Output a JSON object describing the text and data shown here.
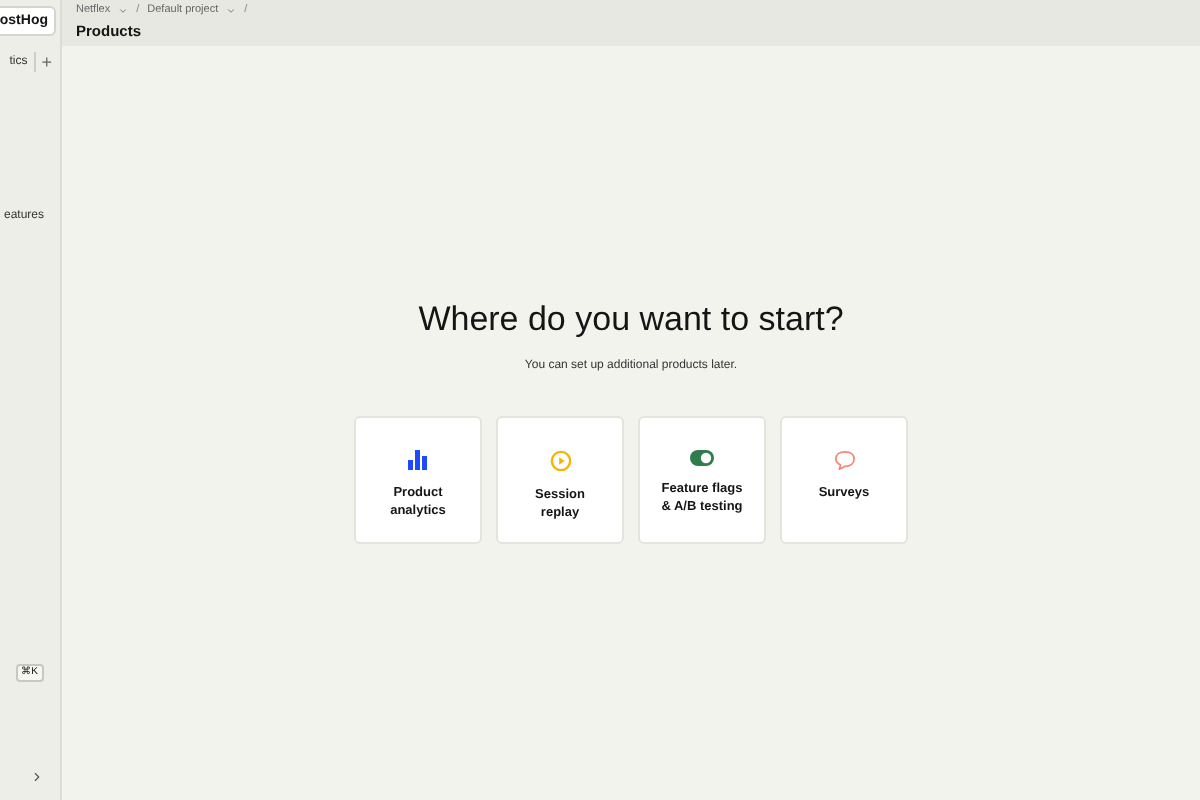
{
  "sidebar": {
    "logo_button": "ostHog",
    "items": [
      {
        "kind": "tab",
        "label": "tics",
        "add": "+"
      },
      {
        "kind": "link",
        "label": "eatures"
      }
    ],
    "shortcut": "⌘K"
  },
  "breadcrumbs": {
    "separator": "/",
    "items": [
      "Netflex",
      "Default project"
    ]
  },
  "page_title": "Products",
  "heading": "Where do you want to start?",
  "subheading": "You can set up additional products later.",
  "products": [
    {
      "kind": "analytics",
      "label": "Product analytics",
      "color": "#1d4aff"
    },
    {
      "kind": "replay",
      "label": "Session replay",
      "color": "#f5b400"
    },
    {
      "kind": "flags",
      "label": "Feature flags & A/B testing",
      "color": "#2f7d4f"
    },
    {
      "kind": "surveys",
      "label": "Surveys",
      "color": "#f08a7a"
    }
  ]
}
